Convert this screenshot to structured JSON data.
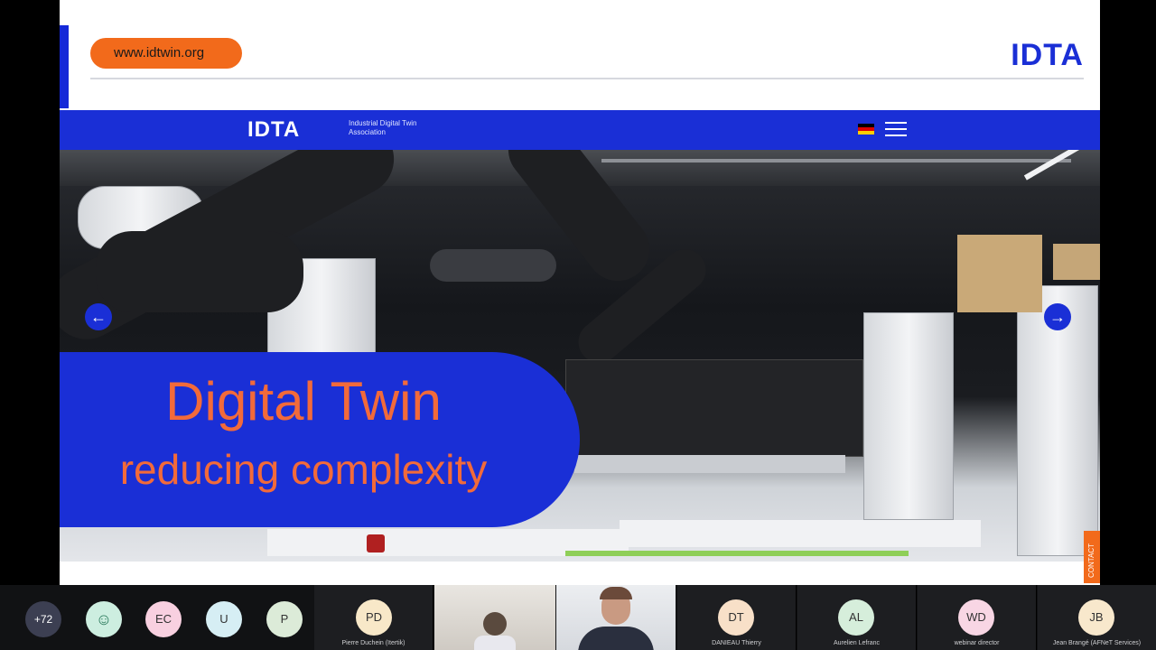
{
  "slide": {
    "url": "www.idtwin.org",
    "logo": "IDTA",
    "accent_blue": "#1a2fd6",
    "accent_orange": "#f26a1b"
  },
  "website": {
    "nav_logo": "IDTA",
    "nav_tagline": "Industrial Digital Twin Association",
    "language_icon": "german-flag-icon",
    "menu_icon": "hamburger-menu-icon",
    "hero_title": "Digital Twin",
    "hero_subtitle": "reducing complexity",
    "prev_arrow": "←",
    "next_arrow": "→",
    "contact_label": "CONTACT"
  },
  "participants": {
    "overflow_count": "+72",
    "avatars": [
      {
        "initials": "",
        "color": "#cdeee0"
      },
      {
        "initials": "EC",
        "color": "#f8d0e0"
      },
      {
        "initials": "U",
        "color": "#d6eef4"
      },
      {
        "initials": "P",
        "color": "#dcebd8"
      }
    ],
    "named_tiles": [
      {
        "initials": "PD",
        "name": "Pierre Duchein (Itertik)",
        "color": "#f8e8c8"
      },
      {
        "initials": "DT",
        "name": "DANIEAU Thierry",
        "color": "#f8e0c8"
      },
      {
        "initials": "AL",
        "name": "Aurelien Lefranc",
        "color": "#d6eedb"
      },
      {
        "initials": "WD",
        "name": "webinar director",
        "color": "#f8d6e4"
      },
      {
        "initials": "JB",
        "name": "Jean Brangé (AFNeT Services)",
        "color": "#f8e8cc"
      }
    ]
  }
}
